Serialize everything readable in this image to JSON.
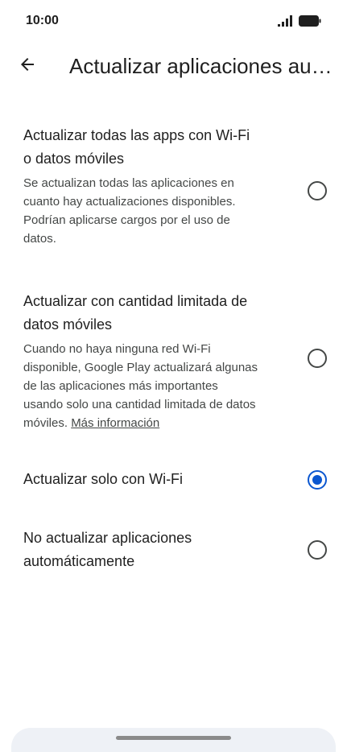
{
  "status_bar": {
    "time": "10:00",
    "icons": [
      "signal-icon",
      "battery-icon"
    ]
  },
  "app_bar": {
    "back_icon": "arrow-back-icon",
    "title": "Actualizar aplicaciones automáticamente"
  },
  "options": [
    {
      "title": "Actualizar todas las apps con Wi-Fi o datos móviles",
      "description": "Se actualizan todas las aplicaciones en cuanto hay actualizaciones disponibles. Podrían aplicarse cargos por el uso de datos.",
      "checked": false
    },
    {
      "title": "Actualizar con cantidad limitada de datos móviles",
      "description": "Cuando no haya ninguna red Wi-Fi disponible, Google Play actualizará algunas de las aplicaciones más importantes usando solo una cantidad limitada de datos móviles.",
      "link": "Más información",
      "checked": false
    },
    {
      "title": "Actualizar solo con Wi-Fi",
      "checked": true
    },
    {
      "title": "No actualizar aplicaciones automáticamente",
      "checked": false
    }
  ],
  "colors": {
    "accent": "#0b57d0",
    "text_primary": "#1f1f1f",
    "text_secondary": "#444746"
  }
}
